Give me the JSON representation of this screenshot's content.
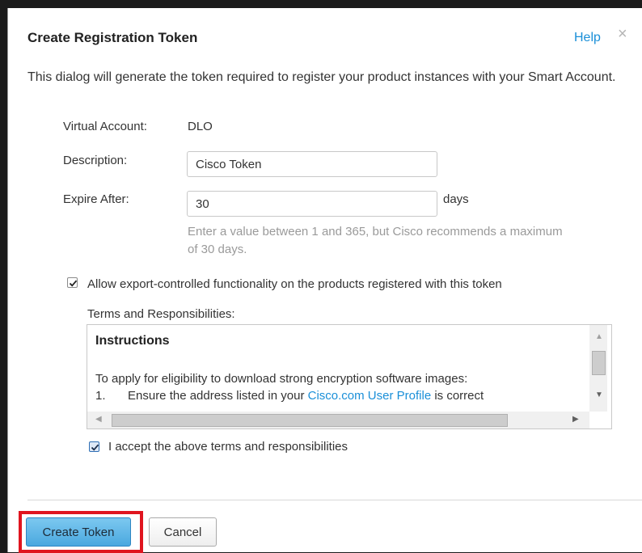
{
  "dialog": {
    "title": "Create Registration Token",
    "help_label": "Help",
    "close_glyph": "×",
    "intro": "This dialog will generate the token required to register your product instances with your Smart Account."
  },
  "form": {
    "virtual_account_label": "Virtual Account:",
    "virtual_account_value": "DLO",
    "description_label": "Description:",
    "description_value": "Cisco Token",
    "expire_label": "Expire After:",
    "expire_value": "30",
    "expire_unit": "days",
    "expire_hint": "Enter a value between 1 and 365, but Cisco recommends a maximum of 30 days."
  },
  "export_control": {
    "checked": true,
    "label": "Allow export-controlled functionality on the products registered with this token"
  },
  "terms": {
    "label": "Terms and Responsibilities:",
    "heading": "Instructions",
    "paragraph": "To apply for eligibility to download strong encryption software images:",
    "item_number": "1.",
    "item_text_before": "Ensure the address listed in your ",
    "item_link": "Cisco.com User Profile",
    "item_text_after": " is correct",
    "scroll_up_glyph": "▲",
    "scroll_down_glyph": "▼",
    "scroll_left_glyph": "◀",
    "scroll_right_glyph": "▶"
  },
  "accept": {
    "checked": true,
    "label": "I accept the above terms and responsibilities"
  },
  "footer": {
    "create_label": "Create Token",
    "cancel_label": "Cancel"
  },
  "colors": {
    "accent": "#1a8fd8",
    "primary_button": "#4aa8df",
    "highlight_border": "#e0151f",
    "hint_text": "#9a9a9a"
  },
  "icons": {
    "close": "close-icon",
    "checkbox": "checkmark-icon"
  }
}
